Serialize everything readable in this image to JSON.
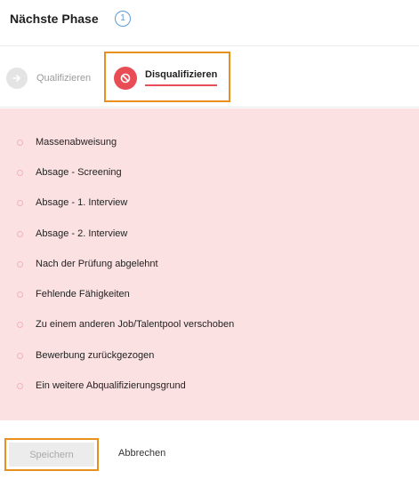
{
  "header": {
    "title": "Nächste Phase",
    "info_badge": "1"
  },
  "tabs": {
    "qualify": {
      "label": "Qualifizieren",
      "icon": "arrow-right-icon"
    },
    "disqualify": {
      "label": "Disqualifizieren",
      "icon": "block-icon",
      "active": true
    }
  },
  "reasons": [
    "Massenabweisung",
    "Absage - Screening",
    "Absage - 1. Interview",
    "Absage - 2. Interview",
    "Nach der Prüfung abgelehnt",
    "Fehlende Fähigkeiten",
    "Zu einem anderen Job/Talentpool verschoben",
    "Bewerbung zurückgezogen",
    "Ein weitere Abqualifizierungsgrund"
  ],
  "footer": {
    "save_label": "Speichern",
    "cancel_label": "Abbrechen"
  },
  "colors": {
    "accent_red": "#e84d56",
    "reason_bg": "#fce1e3",
    "highlight_orange": "#e8901e",
    "info_blue": "#5b9bd5"
  }
}
